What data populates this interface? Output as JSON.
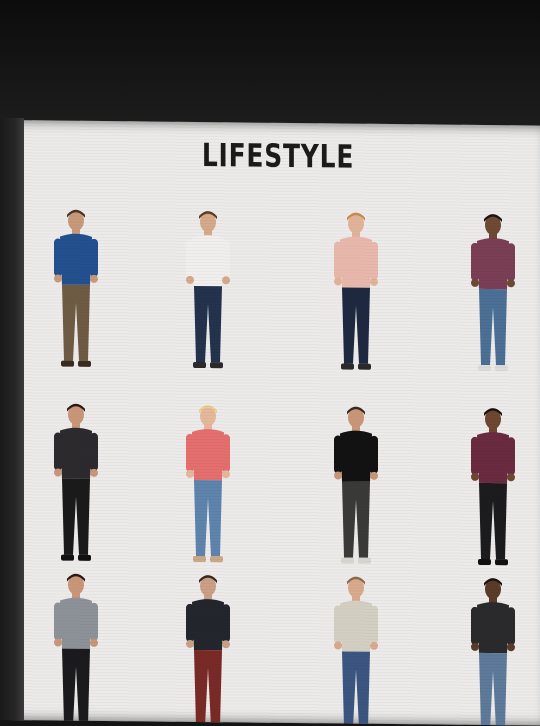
{
  "page": {
    "title": "LIFESTYLE"
  },
  "people": [
    {
      "shirt": "#23508f",
      "pants": "#6f5b43",
      "skin": "#c8997a",
      "hair": "#4a3424",
      "shoes": "#3a2a1f"
    },
    {
      "shirt": "#f1efee",
      "pants": "#23324d",
      "skin": "#d6a98a",
      "hair": "#5a3c27",
      "shoes": "#2a2a2a"
    },
    {
      "shirt": "#e9b8ac",
      "pants": "#1e2840",
      "skin": "#e1b49a",
      "hair": "#c88a4a",
      "shoes": "#2a2a2a"
    },
    {
      "shirt": "#7a3e55",
      "pants": "#4c6f95",
      "skin": "#6e4a35",
      "hair": "#1a1412",
      "shoes": "#dcdcdc"
    },
    {
      "shirt": "#2c2a2e",
      "pants": "#1a1a1a",
      "skin": "#c9967a",
      "hair": "#2b1c14",
      "shoes": "#111111"
    },
    {
      "shirt": "#e46f6e",
      "pants": "#5e84ad",
      "skin": "#e6b89b",
      "hair": "#e7d08a",
      "shoes": "#c9a888"
    },
    {
      "shirt": "#121212",
      "pants": "#3a3a38",
      "skin": "#c99678",
      "hair": "#3a2a20",
      "shoes": "#d9d6d0"
    },
    {
      "shirt": "#6a2a3f",
      "pants": "#1c1c1f",
      "skin": "#6e4632",
      "hair": "#1a1210",
      "shoes": "#111111"
    },
    {
      "shirt": "#8d9299",
      "pants": "#1b1b1e",
      "skin": "#c99678",
      "hair": "#2a1a12",
      "shoes": "#8aa0b8"
    },
    {
      "shirt": "#23262d",
      "pants": "#7a2a26",
      "skin": "#caa086",
      "hair": "#3a281c",
      "shoes": "#2c1a14"
    },
    {
      "shirt": "#d4cfc3",
      "pants": "#3b5680",
      "skin": "#d9aa8c",
      "hair": "#8a6a4a",
      "shoes": "#333333"
    },
    {
      "shirt": "#2a2a2c",
      "pants": "#5e7a9a",
      "skin": "#5a3b2a",
      "hair": "#1a1410",
      "shoes": "#dddddd"
    }
  ]
}
